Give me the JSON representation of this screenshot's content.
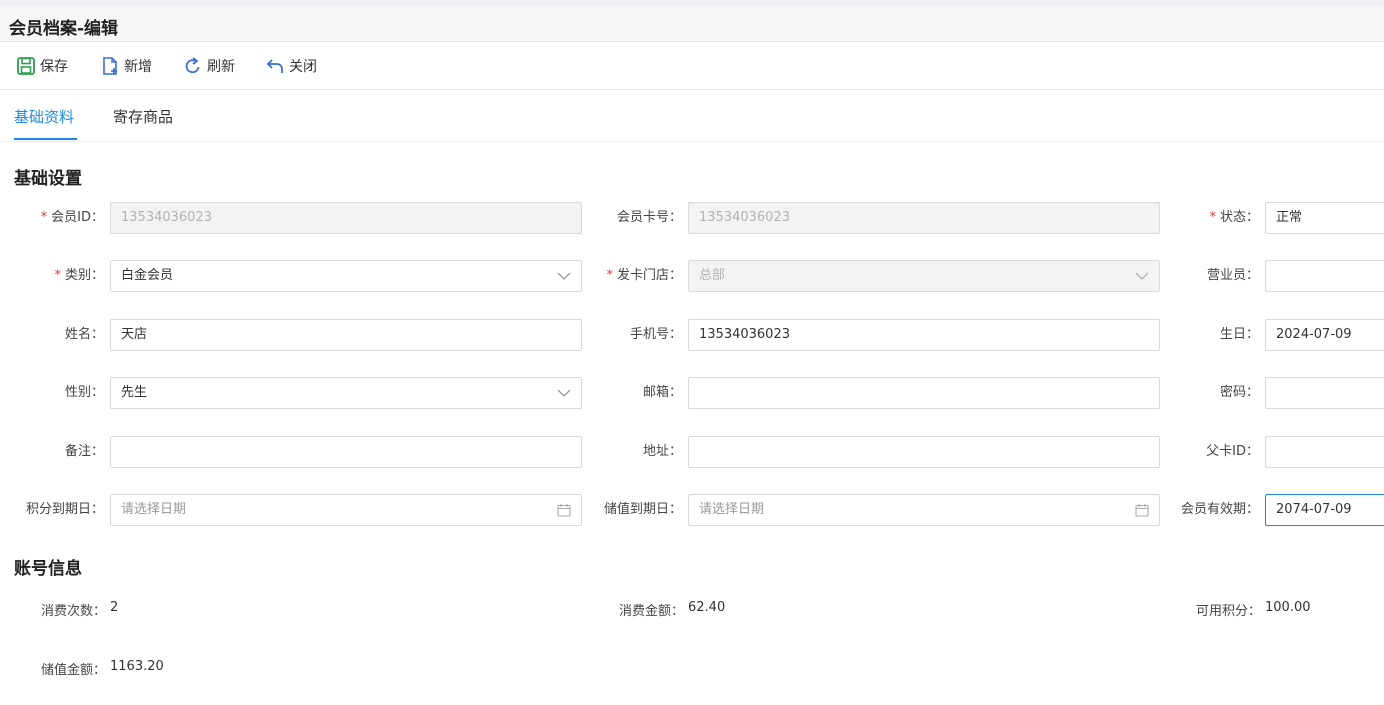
{
  "window": {
    "title": "会员档案-编辑"
  },
  "toolbar": {
    "save": {
      "label": "保存",
      "icon": "save-icon",
      "color": "#2e9e4f"
    },
    "add": {
      "label": "新增",
      "icon": "new-file-icon",
      "color": "#3b6fd1"
    },
    "refresh": {
      "label": "刷新",
      "icon": "refresh-icon",
      "color": "#3b6fd1"
    },
    "close": {
      "label": "关闭",
      "icon": "undo-arrow-icon",
      "color": "#3b6fd1"
    }
  },
  "tabs": [
    {
      "label": "基础资料",
      "active": true
    },
    {
      "label": "寄存商品",
      "active": false
    }
  ],
  "basic": {
    "title": "基础设置",
    "member_id": {
      "label": "会员ID：",
      "value": "13534036023",
      "required": true,
      "disabled": true
    },
    "card_no": {
      "label": "会员卡号：",
      "value": "13534036023",
      "disabled": true
    },
    "status": {
      "label": "状态：",
      "value": "正常",
      "required": true
    },
    "category": {
      "label": "类别：",
      "value": "白金会员",
      "required": true
    },
    "issue_store": {
      "label": "发卡门店：",
      "value": "总部",
      "required": true,
      "disabled": true
    },
    "salesperson": {
      "label": "营业员：",
      "value": ""
    },
    "name": {
      "label": "姓名：",
      "value": "天店"
    },
    "phone": {
      "label": "手机号：",
      "value": "13534036023"
    },
    "birthday": {
      "label": "生日：",
      "value": "2024-07-09"
    },
    "gender": {
      "label": "性别：",
      "value": "先生"
    },
    "email": {
      "label": "邮箱：",
      "value": ""
    },
    "password": {
      "label": "密码：",
      "value": ""
    },
    "remark": {
      "label": "备注：",
      "value": ""
    },
    "address": {
      "label": "地址：",
      "value": ""
    },
    "parent_card": {
      "label": "父卡ID：",
      "value": ""
    },
    "points_expiry": {
      "label": "积分到期日：",
      "placeholder": "请选择日期"
    },
    "stored_expiry": {
      "label": "储值到期日：",
      "placeholder": "请选择日期"
    },
    "valid_until": {
      "label": "会员有效期：",
      "value": "2074-07-09"
    }
  },
  "account": {
    "title": "账号信息",
    "visits": {
      "label": "消费次数：",
      "value": "2"
    },
    "spent": {
      "label": "消费金额：",
      "value": "62.40"
    },
    "points": {
      "label": "可用积分：",
      "value": "100.00"
    },
    "stored": {
      "label": "储值金额：",
      "value": "1163.20"
    }
  },
  "colors": {
    "accent": "#1e88e5",
    "required": "#e53935"
  }
}
